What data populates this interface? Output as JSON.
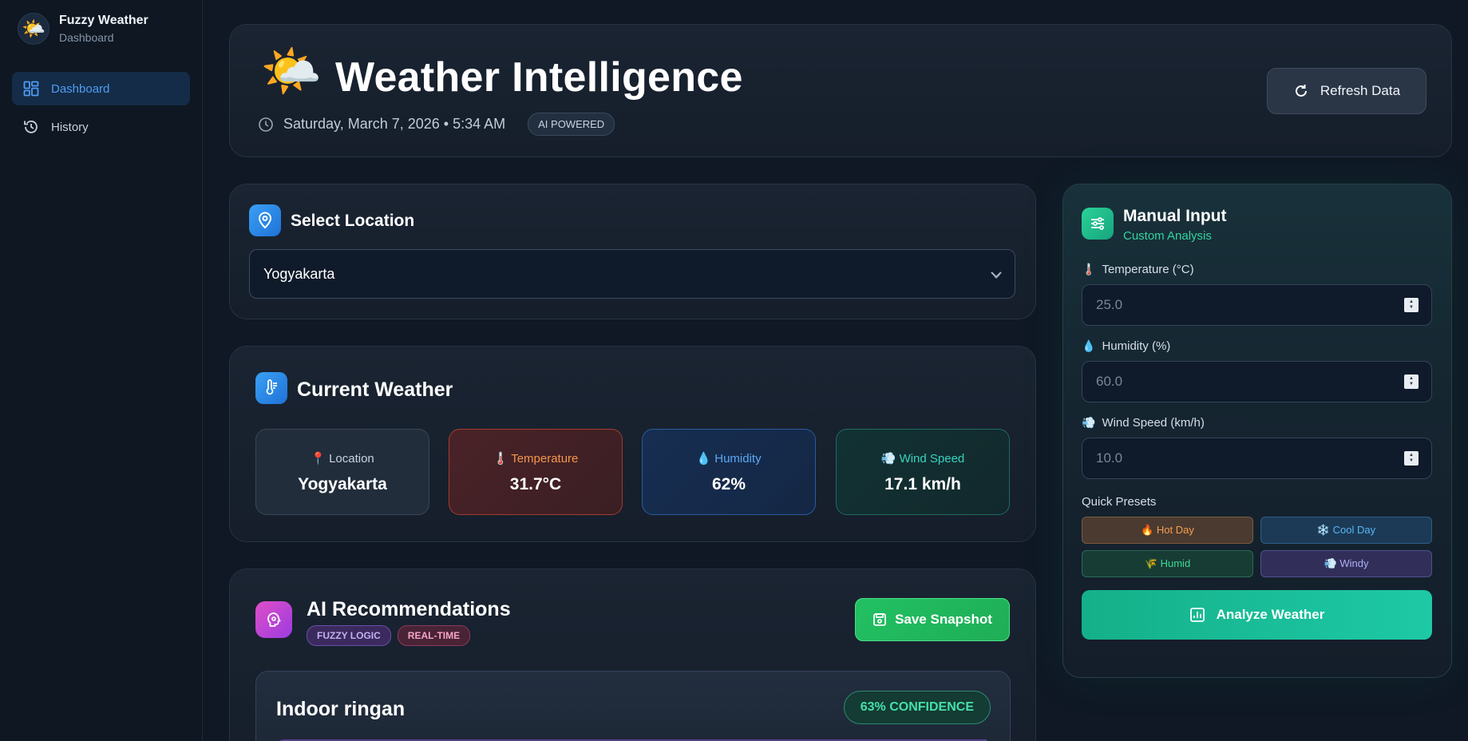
{
  "sidebar": {
    "brand_title": "Fuzzy Weather",
    "brand_sub": "Dashboard",
    "brand_icon": "sun-cloud-icon",
    "items": [
      {
        "label": "Dashboard",
        "icon": "dashboard-icon",
        "active": true
      },
      {
        "label": "History",
        "icon": "history-icon",
        "active": false
      }
    ]
  },
  "header": {
    "icon": "🌤️",
    "title": "Weather Intelligence",
    "date": "Saturday, March 7, 2026 • 5:34 AM",
    "badge": "AI POWERED",
    "refresh_label": "Refresh Data"
  },
  "location": {
    "title": "Select Location",
    "selected": "Yogyakarta"
  },
  "current_weather": {
    "title": "Current Weather",
    "metrics": [
      {
        "icon": "📍",
        "label": "Location",
        "value": "Yogyakarta"
      },
      {
        "icon": "🌡️",
        "label": "Temperature",
        "value": "31.7°C"
      },
      {
        "icon": "💧",
        "label": "Humidity",
        "value": "62%"
      },
      {
        "icon": "💨",
        "label": "Wind Speed",
        "value": "17.1 km/h"
      }
    ]
  },
  "ai": {
    "title": "AI Recommendations",
    "tags": [
      "FUZZY LOGIC",
      "REAL-TIME"
    ],
    "snapshot_label": "Save Snapshot",
    "recommendation": "Indoor ringan",
    "confidence": "63% CONFIDENCE"
  },
  "manual": {
    "title": "Manual Input",
    "subtitle": "Custom Analysis",
    "fields": [
      {
        "icon": "🌡️",
        "label": "Temperature (°C)",
        "placeholder": "25.0"
      },
      {
        "icon": "💧",
        "label": "Humidity (%)",
        "placeholder": "60.0"
      },
      {
        "icon": "💨",
        "label": "Wind Speed (km/h)",
        "placeholder": "10.0"
      }
    ],
    "presets_label": "Quick Presets",
    "presets": [
      "🔥 Hot Day",
      "❄️ Cool Day",
      "🌾 Humid",
      "💨 Windy"
    ],
    "analyze_label": "Analyze Weather"
  },
  "colors": {
    "accent_blue": "#4f9cf5",
    "accent_green": "#1ec9a6",
    "background": "#0f1824"
  }
}
